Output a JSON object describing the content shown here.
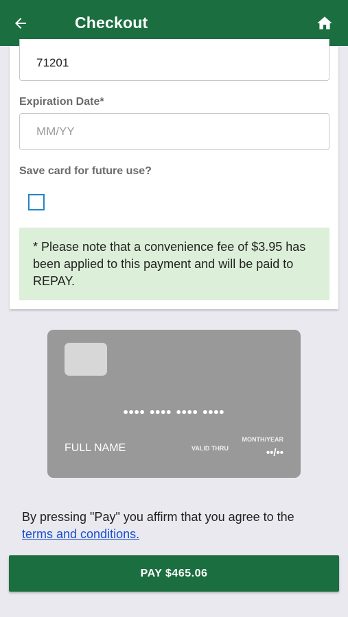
{
  "header": {
    "title": "Checkout",
    "back_icon": "arrow-left-icon",
    "home_icon": "home-icon"
  },
  "form": {
    "zip_value": "71201",
    "expiration_label": "Expiration Date*",
    "expiration_placeholder": "MM/YY",
    "save_card_label": "Save card for future use?",
    "save_card_checked": false,
    "fee_notice": "* Please note that a convenience fee of $3.95 has been applied to this payment and will be paid to REPAY."
  },
  "card_preview": {
    "number_mask": "•••• •••• •••• ••••",
    "full_name": "FULL NAME",
    "valid_thru": "VALID THRU",
    "month_year": "MONTH/YEAR",
    "expiry_mask": "••/••"
  },
  "footer": {
    "affirm_text": "By pressing \"Pay\" you affirm that you agree to the",
    "terms_link": "terms and conditions.",
    "pay_button": "PAY $465.06"
  },
  "colors": {
    "primary": "#1b6e3f",
    "notice_bg": "#dcefd8",
    "checkbox_border": "#1f86c8",
    "link": "#1a4fd0"
  }
}
